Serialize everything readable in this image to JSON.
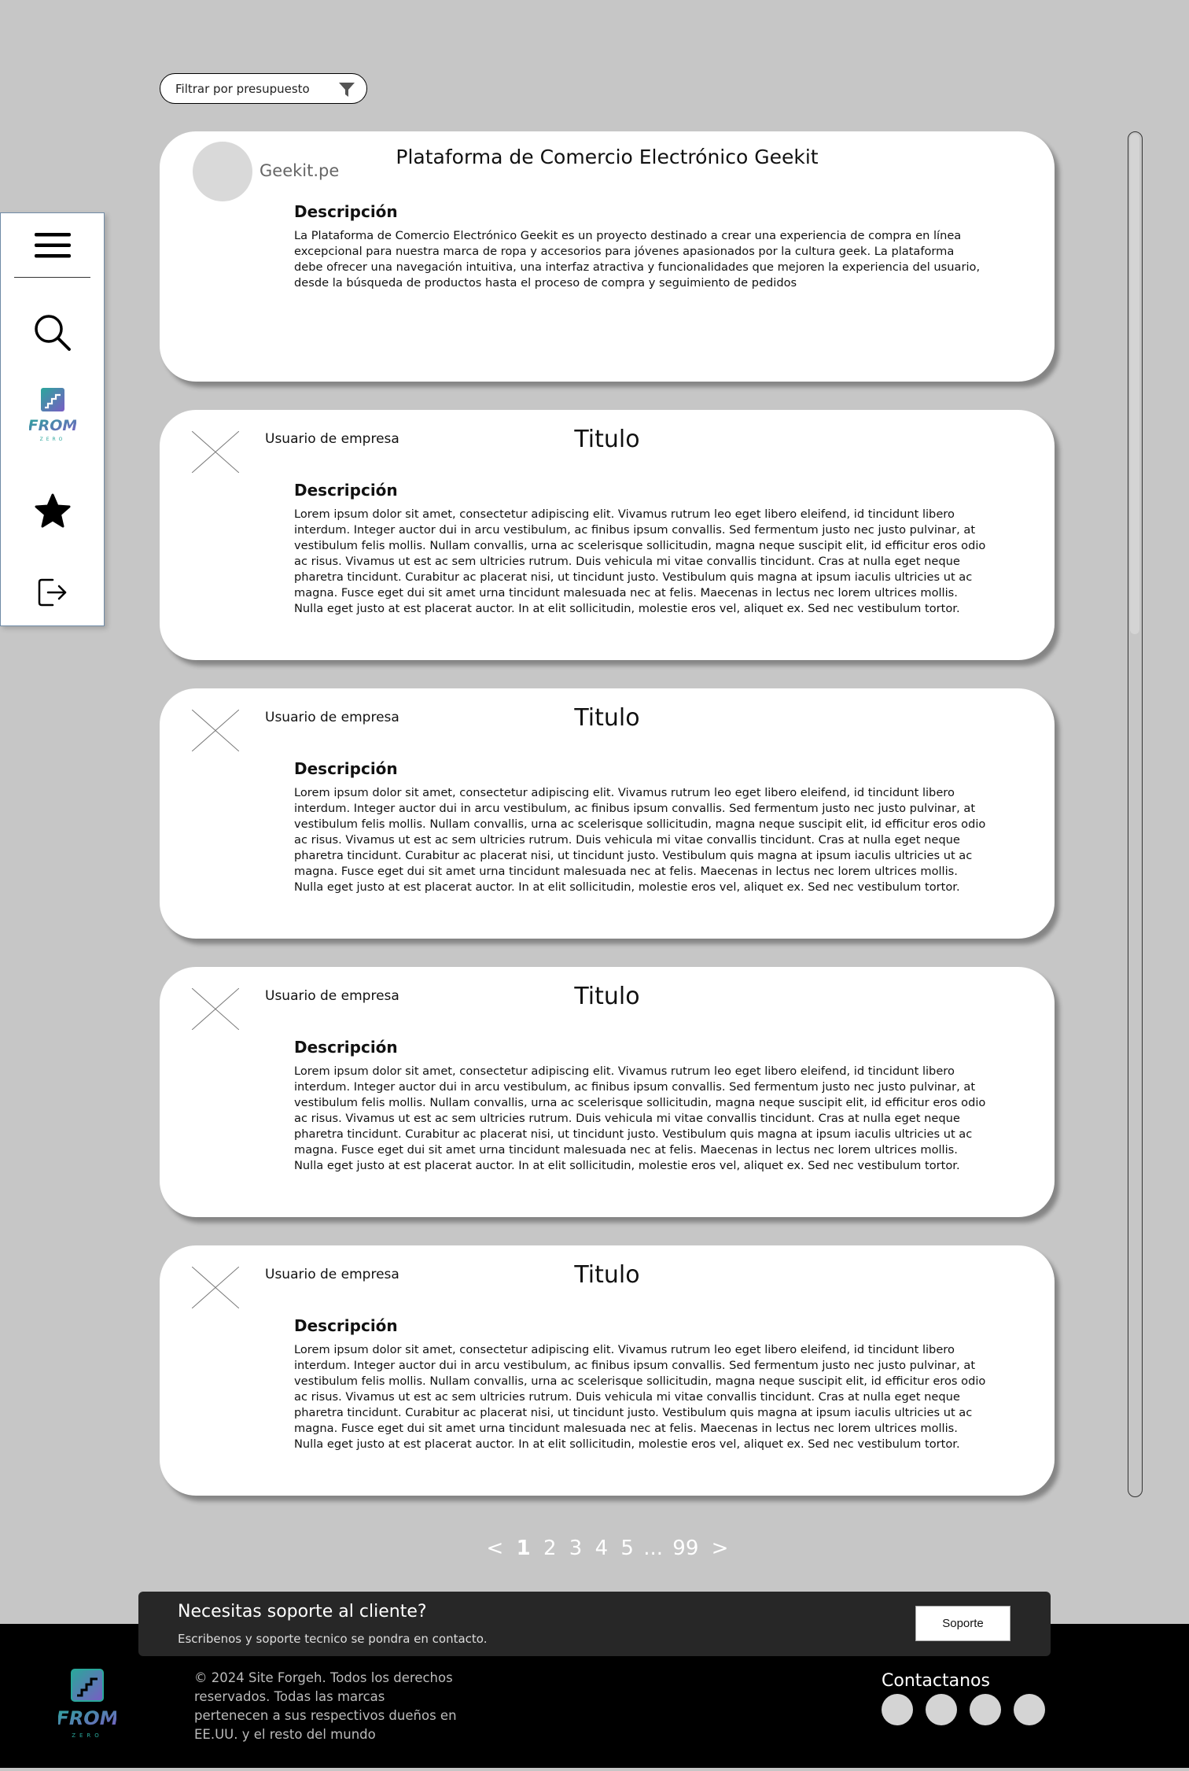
{
  "filter": {
    "label": "Filtrar por presupuesto",
    "icon": "filter-icon"
  },
  "sidebar": {
    "items": [
      {
        "name": "menu",
        "icon": "hamburger-menu-icon"
      },
      {
        "name": "search",
        "icon": "search-icon"
      },
      {
        "name": "home",
        "icon": "fromzero-logo",
        "logo_text": "FROM",
        "logo_subtext": "ZERO"
      },
      {
        "name": "favorites",
        "icon": "star-icon"
      },
      {
        "name": "logout",
        "icon": "logout-icon"
      }
    ]
  },
  "featured_project": {
    "company_name": "Geekit.pe",
    "title": "Plataforma de Comercio Electrónico Geekit",
    "description_heading": "Descripción",
    "description": "La Plataforma de Comercio Electrónico Geekit es un proyecto destinado a crear una experiencia de compra en línea excepcional para nuestra marca de ropa y accesorios para jóvenes apasionados por la cultura geek. La plataforma debe ofrecer una navegación intuitiva, una interfaz atractiva y funcionalidades que mejoren la experiencia del usuario, desde la búsqueda de productos hasta el proceso de compra y seguimiento de pedidos"
  },
  "projects": [
    {
      "user_label": "Usuario de empresa",
      "title": "Titulo",
      "description_heading": "Descripción",
      "description": "Lorem ipsum dolor sit amet, consectetur adipiscing elit. Vivamus rutrum leo eget libero eleifend, id tincidunt libero interdum. Integer auctor dui in arcu vestibulum, ac finibus ipsum convallis. Sed fermentum justo nec justo pulvinar, at vestibulum felis mollis. Nullam convallis, urna ac scelerisque sollicitudin, magna neque suscipit elit, id efficitur eros odio ac risus. Vivamus ut est ac sem ultricies rutrum. Duis vehicula mi vitae convallis tincidunt. Cras at nulla eget neque pharetra tincidunt. Curabitur ac placerat nisi, ut tincidunt justo. Vestibulum quis magna at ipsum iaculis ultricies ut ac magna. Fusce eget dui sit amet urna tincidunt malesuada nec at felis. Maecenas in lectus nec lorem ultrices mollis. Nulla eget justo at est placerat auctor. In at elit sollicitudin, molestie eros vel, aliquet ex. Sed nec vestibulum tortor."
    },
    {
      "user_label": "Usuario de empresa",
      "title": "Titulo",
      "description_heading": "Descripción",
      "description": "Lorem ipsum dolor sit amet, consectetur adipiscing elit. Vivamus rutrum leo eget libero eleifend, id tincidunt libero interdum. Integer auctor dui in arcu vestibulum, ac finibus ipsum convallis. Sed fermentum justo nec justo pulvinar, at vestibulum felis mollis. Nullam convallis, urna ac scelerisque sollicitudin, magna neque suscipit elit, id efficitur eros odio ac risus. Vivamus ut est ac sem ultricies rutrum. Duis vehicula mi vitae convallis tincidunt. Cras at nulla eget neque pharetra tincidunt. Curabitur ac placerat nisi, ut tincidunt justo. Vestibulum quis magna at ipsum iaculis ultricies ut ac magna. Fusce eget dui sit amet urna tincidunt malesuada nec at felis. Maecenas in lectus nec lorem ultrices mollis. Nulla eget justo at est placerat auctor. In at elit sollicitudin, molestie eros vel, aliquet ex. Sed nec vestibulum tortor."
    },
    {
      "user_label": "Usuario de empresa",
      "title": "Titulo",
      "description_heading": "Descripción",
      "description": "Lorem ipsum dolor sit amet, consectetur adipiscing elit. Vivamus rutrum leo eget libero eleifend, id tincidunt libero interdum. Integer auctor dui in arcu vestibulum, ac finibus ipsum convallis. Sed fermentum justo nec justo pulvinar, at vestibulum felis mollis. Nullam convallis, urna ac scelerisque sollicitudin, magna neque suscipit elit, id efficitur eros odio ac risus. Vivamus ut est ac sem ultricies rutrum. Duis vehicula mi vitae convallis tincidunt. Cras at nulla eget neque pharetra tincidunt. Curabitur ac placerat nisi, ut tincidunt justo. Vestibulum quis magna at ipsum iaculis ultricies ut ac magna. Fusce eget dui sit amet urna tincidunt malesuada nec at felis. Maecenas in lectus nec lorem ultrices mollis. Nulla eget justo at est placerat auctor. In at elit sollicitudin, molestie eros vel, aliquet ex. Sed nec vestibulum tortor."
    },
    {
      "user_label": "Usuario de empresa",
      "title": "Titulo",
      "description_heading": "Descripción",
      "description": "Lorem ipsum dolor sit amet, consectetur adipiscing elit. Vivamus rutrum leo eget libero eleifend, id tincidunt libero interdum. Integer auctor dui in arcu vestibulum, ac finibus ipsum convallis. Sed fermentum justo nec justo pulvinar, at vestibulum felis mollis. Nullam convallis, urna ac scelerisque sollicitudin, magna neque suscipit elit, id efficitur eros odio ac risus. Vivamus ut est ac sem ultricies rutrum. Duis vehicula mi vitae convallis tincidunt. Cras at nulla eget neque pharetra tincidunt. Curabitur ac placerat nisi, ut tincidunt justo. Vestibulum quis magna at ipsum iaculis ultricies ut ac magna. Fusce eget dui sit amet urna tincidunt malesuada nec at felis. Maecenas in lectus nec lorem ultrices mollis. Nulla eget justo at est placerat auctor. In at elit sollicitudin, molestie eros vel, aliquet ex. Sed nec vestibulum tortor."
    }
  ],
  "pagination": {
    "prev": "<",
    "pages": [
      "1",
      "2",
      "3",
      "4",
      "5"
    ],
    "ellipsis": "...",
    "last": "99",
    "next": ">",
    "current": "1"
  },
  "support": {
    "title": "Necesitas soporte al cliente?",
    "subtitle": "Escribenos y soporte tecnico se pondra en contacto.",
    "button_label": "Soporte"
  },
  "footer": {
    "logo_text": "FROM",
    "logo_subtext": "ZERO",
    "copyright": "© 2024 Site Forgeh. Todos los derechos reservados. Todas las marcas pertenecen a sus respectivos dueños en EE.UU. y el resto del mundo",
    "contact_title": "Contactanos",
    "social_icons": [
      "social-icon-1",
      "social-icon-2",
      "social-icon-3",
      "social-icon-4"
    ]
  },
  "colors": {
    "background": "#c6c6c6",
    "card": "#ffffff",
    "footer": "#000000",
    "support_banner": "#272727",
    "logo_teal": "#2aa79b",
    "logo_purple": "#7a5cc4"
  }
}
